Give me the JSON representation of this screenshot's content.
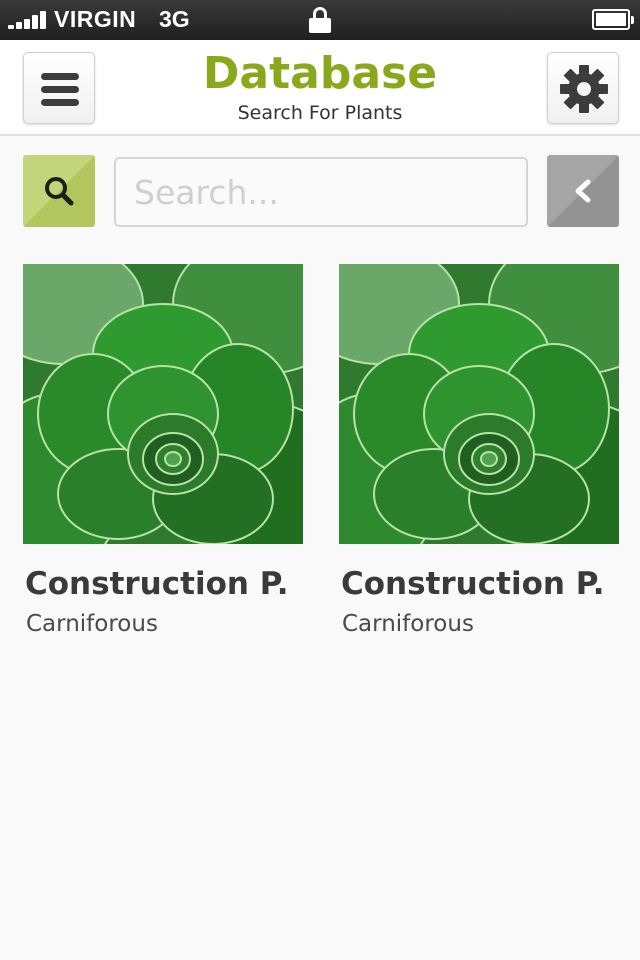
{
  "status_bar": {
    "carrier": "VIRGIN",
    "network": "3G",
    "icons": [
      "signal-icon",
      "lock-icon",
      "battery-icon"
    ]
  },
  "header": {
    "title": "Database",
    "subtitle": "Search For Plants",
    "menu_icon": "hamburger-menu-icon",
    "settings_icon": "gear-icon"
  },
  "search": {
    "placeholder": "Search...",
    "value": "",
    "search_icon": "magnifier-icon",
    "back_icon": "chevron-left-icon"
  },
  "plants": [
    {
      "name": "Construction P.",
      "type": "Carniforous"
    },
    {
      "name": "Construction P.",
      "type": "Carniforous"
    }
  ],
  "colors": {
    "brand_green": "#89a81b",
    "search_button": "#c4d47a",
    "back_button": "#a5a5a5",
    "text_dark": "#3a3a3a"
  }
}
